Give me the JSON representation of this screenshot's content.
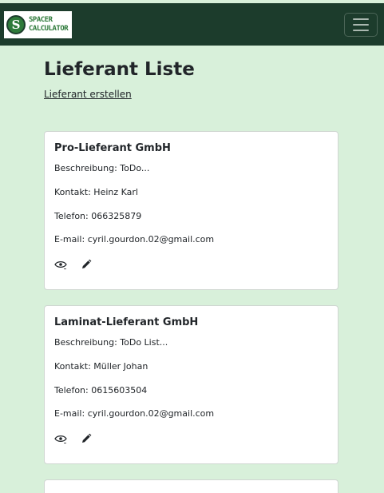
{
  "header": {
    "logo_text_line1": "SPACER",
    "logo_text_line2": "CALCULATOR",
    "logo_letter": "S",
    "menu_icon": "hamburger-icon",
    "brand_color": "#1c3c2c"
  },
  "page": {
    "title": "Lieferant Liste",
    "create_link": "Lieferant erstellen",
    "background_color": "#d8f0da"
  },
  "suppliers": [
    {
      "name": "Pro-Lieferant GmbH",
      "description": "Beschreibung: ToDo...",
      "contact": "Kontakt: Heinz Karl",
      "phone": "Telefon: 066325879",
      "email": "E-mail: cyril.gourdon.02@gmail.com",
      "actions": [
        "eye-icon",
        "pencil-icon"
      ]
    },
    {
      "name": "Laminat-Lieferant GmbH",
      "description": "Beschreibung: ToDo List...",
      "contact": "Kontakt: Müller Johan",
      "phone": "Telefon: 0615603504",
      "email": "E-mail: cyril.gourdon.02@gmail.com",
      "actions": [
        "eye-icon",
        "pencil-icon"
      ]
    }
  ]
}
